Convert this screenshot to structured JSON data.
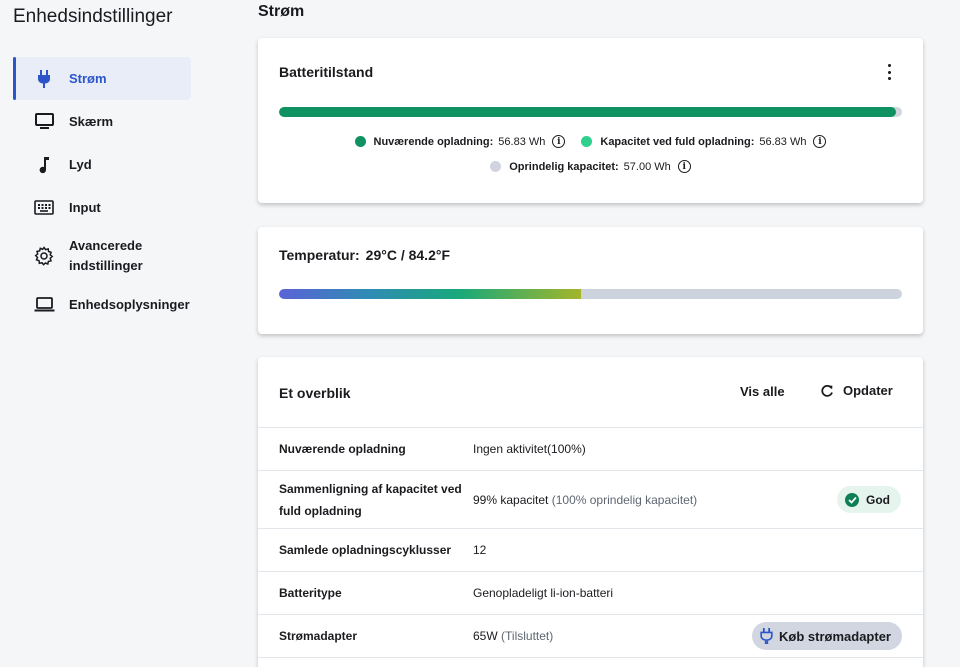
{
  "app": {
    "title": "Enhedsindstillinger"
  },
  "sidebar": {
    "items": [
      {
        "label": "Strøm",
        "icon": "plug-icon",
        "active": true
      },
      {
        "label": "Skærm",
        "icon": "monitor-icon"
      },
      {
        "label": "Lyd",
        "icon": "music-note-icon"
      },
      {
        "label": "Input",
        "icon": "keyboard-icon"
      },
      {
        "label": "Avancerede indstillinger",
        "icon": "gear-icon"
      },
      {
        "label": "Enhedsoplysninger",
        "icon": "laptop-icon"
      }
    ]
  },
  "page": {
    "heading": "Strøm"
  },
  "battery": {
    "title": "Batteritilstand",
    "charge_fraction": 0.99,
    "legend": [
      {
        "label": "Nuværende opladning:",
        "value": "56.83 Wh",
        "color": "#0f9162"
      },
      {
        "label": "Kapacitet ved fuld opladning:",
        "value": "56.83 Wh",
        "color": "#2fcf8e"
      },
      {
        "label": "Oprindelig kapacitet:",
        "value": "57.00 Wh",
        "color": "#cfd4df"
      }
    ]
  },
  "temperature": {
    "label": "Temperatur:",
    "value": "29°C / 84.2°F",
    "level_fraction": 0.485
  },
  "overview": {
    "title": "Et overblik",
    "view_all": "Vis alle",
    "refresh": "Opdater",
    "rows": [
      {
        "key": "Nuværende opladning",
        "value": "Ingen aktivitet(100%)",
        "muted": ""
      },
      {
        "key": "Sammenligning af kapacitet ved fuld opladning",
        "value": "99% kapacitet",
        "muted": "(100% oprindelig kapacitet)",
        "badge": "God"
      },
      {
        "key": "Samlede opladningscyklusser",
        "value": "12",
        "muted": ""
      },
      {
        "key": "Batteritype",
        "value": "Genopladeligt li-ion-batteri",
        "muted": ""
      },
      {
        "key": "Strømadapter",
        "value": "65W",
        "muted": "(Tilsluttet)",
        "button": "Køb strømadapter"
      }
    ]
  },
  "colors": {
    "accent": "#2b55c9",
    "good": "#0f7f57"
  }
}
